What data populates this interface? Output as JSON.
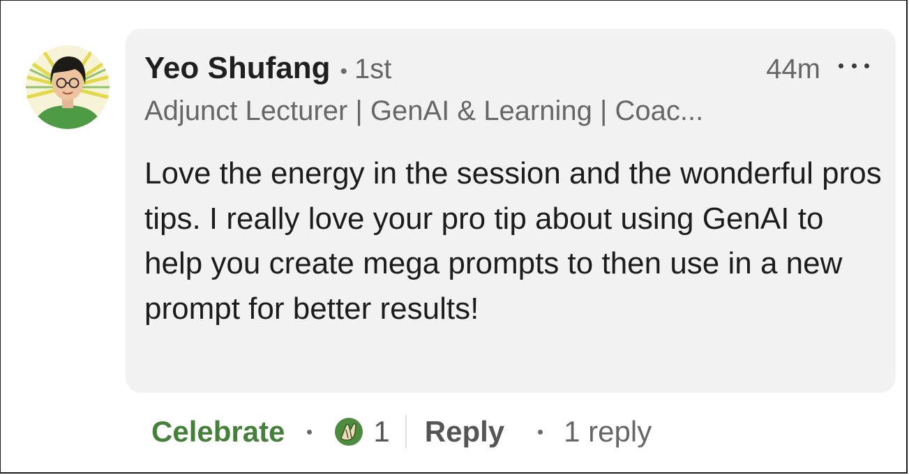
{
  "comment": {
    "author": {
      "name": "Yeo Shufang",
      "connection_degree": "1st",
      "headline": "Adjunct Lecturer | GenAI & Learning | Coac..."
    },
    "timestamp": "44m",
    "text": "Love the energy in the session and the wonderful pros tips. I really love your pro tip about using GenAI to help you create mega prompts to then use in a new prompt for better results!"
  },
  "actions": {
    "reaction_label": "Celebrate",
    "reaction_count": "1",
    "reply_label": "Reply",
    "replies_count_label": "1 reply"
  },
  "icons": {
    "more": "more-options-icon",
    "reaction": "celebrate-reaction-icon"
  },
  "colors": {
    "celebrate_green": "#44803a",
    "bubble_bg": "#f2f2f2"
  }
}
